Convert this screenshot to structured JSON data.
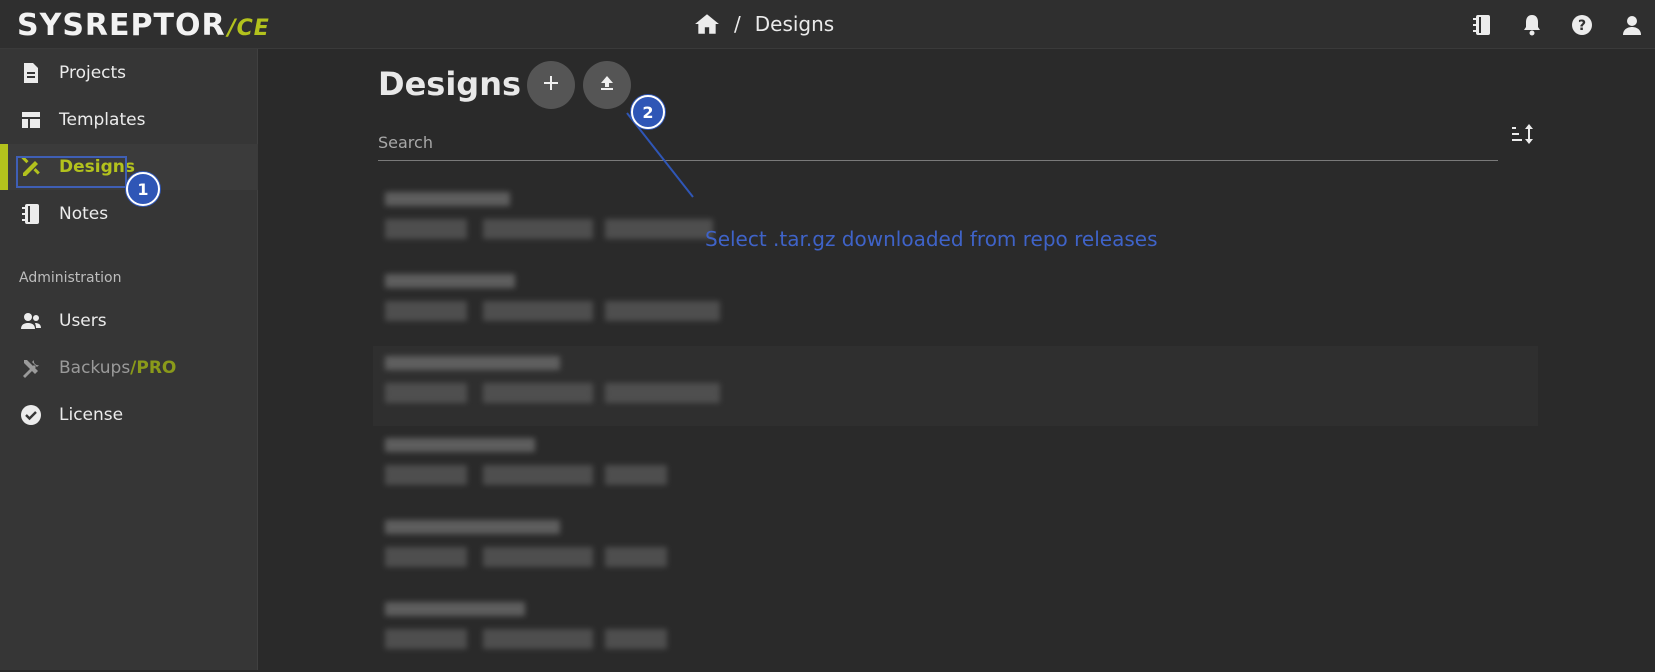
{
  "app": {
    "logo_main": "SYSREPTOR",
    "logo_suffix": "/CE"
  },
  "breadcrumb": {
    "separator": "/",
    "current": "Designs"
  },
  "topbar": {
    "icons": [
      "notebook-icon",
      "bell-icon",
      "help-icon",
      "account-icon"
    ]
  },
  "sidebar": {
    "items": [
      {
        "label": "Projects",
        "icon": "file-document-icon"
      },
      {
        "label": "Templates",
        "icon": "table-layout-icon"
      },
      {
        "label": "Designs",
        "icon": "pencil-ruler-icon",
        "active": true
      },
      {
        "label": "Notes",
        "icon": "notebook-icon"
      }
    ],
    "admin_heading": "Administration",
    "admin_items": [
      {
        "label": "Users",
        "icon": "users-icon"
      },
      {
        "label": "Backups",
        "suffix": "/PRO",
        "icon": "tools-icon",
        "disabled": true
      },
      {
        "label": "License",
        "icon": "check-decagram-icon"
      }
    ]
  },
  "main": {
    "title": "Designs",
    "search": {
      "placeholder": "Search",
      "value": ""
    }
  },
  "annotations": {
    "badge1": "1",
    "badge2": "2",
    "note": "Select .tar.gz downloaded from repo releases"
  },
  "colors": {
    "accent": "#b3c21d",
    "annotation": "#2f56b6",
    "background": "#2a2a2a",
    "sidebar": "#363636"
  }
}
